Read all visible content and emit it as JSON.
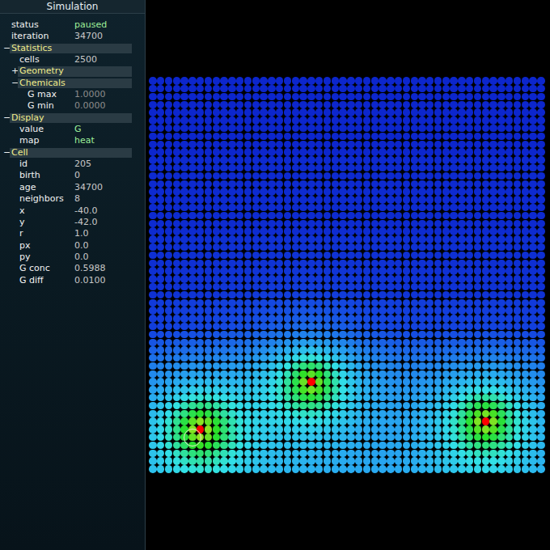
{
  "panel": {
    "title": "Simulation",
    "rows": [
      {
        "kind": "field",
        "depth": 0,
        "label": "status",
        "value": "paused",
        "accent": true,
        "dim": false
      },
      {
        "kind": "field",
        "depth": 0,
        "label": "iteration",
        "value": "34700",
        "accent": false,
        "dim": false
      },
      {
        "kind": "section",
        "depth": 0,
        "toggle": "−",
        "label": "Statistics"
      },
      {
        "kind": "field",
        "depth": 1,
        "label": "cells",
        "value": "2500",
        "accent": false,
        "dim": false
      },
      {
        "kind": "section",
        "depth": 1,
        "toggle": "+",
        "label": "Geometry"
      },
      {
        "kind": "section",
        "depth": 1,
        "toggle": "−",
        "label": "Chemicals"
      },
      {
        "kind": "field",
        "depth": 2,
        "label": "G max",
        "value": "1.0000",
        "accent": false,
        "dim": true
      },
      {
        "kind": "field",
        "depth": 2,
        "label": "G min",
        "value": "0.0000",
        "accent": false,
        "dim": true
      },
      {
        "kind": "section",
        "depth": 0,
        "toggle": "−",
        "label": "Display"
      },
      {
        "kind": "field",
        "depth": 1,
        "label": "value",
        "value": "G",
        "accent": true,
        "dim": false
      },
      {
        "kind": "field",
        "depth": 1,
        "label": "map",
        "value": "heat",
        "accent": true,
        "dim": false
      },
      {
        "kind": "section",
        "depth": 0,
        "toggle": "−",
        "label": "Cell"
      },
      {
        "kind": "field",
        "depth": 1,
        "label": "id",
        "value": "205",
        "accent": false,
        "dim": false
      },
      {
        "kind": "field",
        "depth": 1,
        "label": "birth",
        "value": "0",
        "accent": false,
        "dim": false
      },
      {
        "kind": "field",
        "depth": 1,
        "label": "age",
        "value": "34700",
        "accent": false,
        "dim": false
      },
      {
        "kind": "field",
        "depth": 1,
        "label": "neighbors",
        "value": "8",
        "accent": false,
        "dim": false
      },
      {
        "kind": "field",
        "depth": 1,
        "label": "x",
        "value": "-40.0",
        "accent": false,
        "dim": false
      },
      {
        "kind": "field",
        "depth": 1,
        "label": "y",
        "value": "-42.0",
        "accent": false,
        "dim": false
      },
      {
        "kind": "field",
        "depth": 1,
        "label": "r",
        "value": "1.0",
        "accent": false,
        "dim": false
      },
      {
        "kind": "field",
        "depth": 1,
        "label": "px",
        "value": "0.0",
        "accent": false,
        "dim": false
      },
      {
        "kind": "field",
        "depth": 1,
        "label": "py",
        "value": "0.0",
        "accent": false,
        "dim": false
      },
      {
        "kind": "field",
        "depth": 1,
        "label": "G conc",
        "value": "0.5988",
        "accent": false,
        "dim": false
      },
      {
        "kind": "field",
        "depth": 1,
        "label": "G diff",
        "value": "0.0100",
        "accent": false,
        "dim": false
      }
    ]
  },
  "grid": {
    "cols": 50,
    "rows": 50,
    "row_levels": [
      0.02,
      0.02,
      0.02,
      0.02,
      0.02,
      0.02,
      0.02,
      0.02,
      0.02,
      0.02,
      0.03,
      0.03,
      0.03,
      0.03,
      0.03,
      0.03,
      0.03,
      0.03,
      0.03,
      0.03,
      0.04,
      0.04,
      0.04,
      0.04,
      0.04,
      0.04,
      0.04,
      0.04,
      0.06,
      0.06,
      0.06,
      0.06,
      0.08,
      0.1,
      0.12,
      0.14,
      0.16,
      0.17,
      0.18,
      0.19,
      0.2,
      0.21,
      0.21,
      0.22,
      0.22,
      0.23,
      0.24,
      0.24,
      0.25,
      0.26
    ],
    "sources": [
      {
        "col": 6,
        "row": 44,
        "level": 1
      },
      {
        "col": 20,
        "row": 38,
        "level": 1
      },
      {
        "col": 42,
        "row": 43,
        "level": 1
      }
    ],
    "strength": 0.6,
    "spread": 4,
    "selected_cell": {
      "col": 5,
      "row": 45
    }
  }
}
